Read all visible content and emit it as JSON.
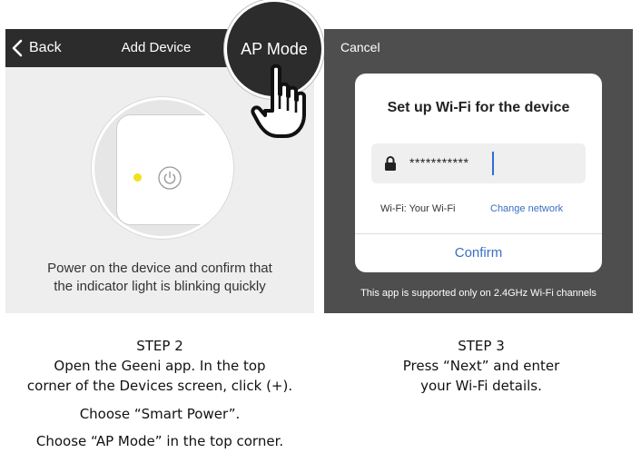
{
  "left_screen": {
    "nav": {
      "back_label": "Back",
      "title": "Add Device"
    },
    "ap_mode_label": "AP Mode",
    "instruction_line1": "Power on the device and confirm that",
    "instruction_line2": "the indicator light is blinking quickly",
    "indicator_color": "#f3e11b"
  },
  "right_screen": {
    "cancel_label": "Cancel",
    "dialog": {
      "title": "Set up Wi-Fi for the device",
      "password_value": "***********",
      "wifi_label": "Wi-Fi: Your Wi-Fi",
      "change_network_label": "Change network",
      "confirm_label": "Confirm"
    },
    "footnote": "This app is supported only on 2.4GHz Wi-Fi channels",
    "accent_color": "#3a6fc5"
  },
  "captions": {
    "step2": {
      "heading": "STEP 2",
      "line1": "Open the Geeni app. In the top",
      "line2": "corner of the Devices screen, click (+).",
      "line3": "Choose “Smart Power”.",
      "line4": "Choose “AP Mode” in the top corner."
    },
    "step3": {
      "heading": "STEP 3",
      "line1": "Press “Next” and enter",
      "line2": "your Wi-Fi details."
    }
  },
  "icons": {
    "back": "chevron-left-icon",
    "power": "power-icon",
    "hand": "pointing-hand-icon",
    "lock": "lock-icon"
  }
}
